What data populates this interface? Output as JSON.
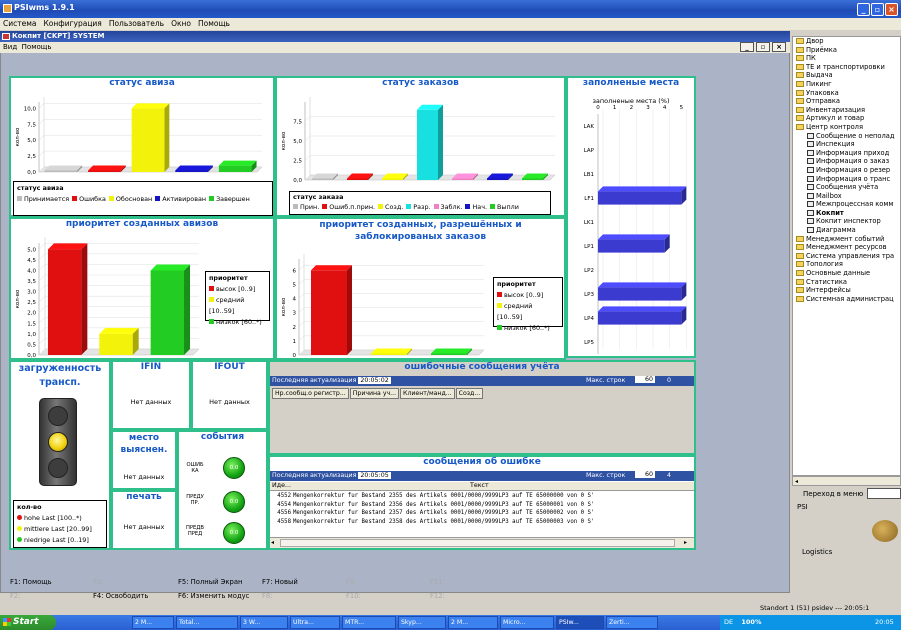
{
  "app": {
    "title": "PSIwms 1.9.1",
    "menu": [
      "Система",
      "Конфигурация",
      "Пользователь",
      "Окно",
      "Помощь"
    ]
  },
  "inner": {
    "title": "Кокпит [CKPT] SYSTEM",
    "menu": [
      "Вид",
      "Помощь"
    ]
  },
  "panels": {
    "avis_status": {
      "title": "статус авиза",
      "ylabel": "кол-во",
      "legend_title": "статус авиза",
      "legend": [
        {
          "label": "Принимается",
          "color": "#bbbbbb"
        },
        {
          "label": "Ошибка",
          "color": "#e01010"
        },
        {
          "label": "Обоснован",
          "color": "#f2f20a"
        },
        {
          "label": "Активирован",
          "color": "#1515c0"
        },
        {
          "label": "Завершен",
          "color": "#22cc22"
        }
      ]
    },
    "order_status": {
      "title": "статус заказов",
      "ylabel": "кол-во",
      "legend_title": "статус заказа",
      "legend": [
        {
          "label": "Прин.",
          "color": "#bbbbbb"
        },
        {
          "label": "Ошиб.п.прин.",
          "color": "#e01010"
        },
        {
          "label": "Созд.",
          "color": "#f2f20a"
        },
        {
          "label": "Разр.",
          "color": "#19e0e0"
        },
        {
          "label": "Заблк.",
          "color": "#f080c0"
        },
        {
          "label": "Нач.",
          "color": "#1515c0"
        },
        {
          "label": "Выпли",
          "color": "#22cc22"
        }
      ]
    },
    "places": {
      "title": "заполненые места",
      "subtitle": "заполненые места (%)"
    },
    "avis_priority": {
      "title": "приоритет созданных авизов",
      "ylabel": "кол-во",
      "legend_title": "приоритет",
      "legend": [
        {
          "label": "высок [0..9]",
          "color": "#e01010"
        },
        {
          "label": "средний [10..59]",
          "color": "#f2f20a"
        },
        {
          "label": "низкок [60..*)",
          "color": "#22cc22"
        }
      ]
    },
    "order_priority": {
      "title1": "приоритет созданных, разрешённых и",
      "title2": "заблокированых заказов",
      "ylabel": "кол-во",
      "legend_title": "приоритет",
      "legend": [
        {
          "label": "высок [0..9]",
          "color": "#e01010"
        },
        {
          "label": "средний [10..59]",
          "color": "#f2f20a"
        },
        {
          "label": "низкок [60..*)",
          "color": "#22cc22"
        }
      ]
    },
    "load": {
      "title1": "загруженность",
      "title2": "трансп.",
      "legend_title": "кол-во",
      "legend": [
        {
          "label": "hohe Last [100..*)",
          "color": "#e01010"
        },
        {
          "label": "mittlere Last [20..99]",
          "color": "#f2f20a"
        },
        {
          "label": "niedrige Last [0..19]",
          "color": "#22cc22"
        }
      ]
    },
    "ifin": {
      "title": "IFIN",
      "text": "Нет данных"
    },
    "ifout": {
      "title": "IFOUT",
      "text": "Нет данных"
    },
    "place_clar": {
      "title1": "место",
      "title2": "выяснен.",
      "text": "Нет данных"
    },
    "print": {
      "title": "печать",
      "text": "Нет данных"
    },
    "events": {
      "title": "события",
      "items": [
        {
          "label1": "ОШИБ",
          "label2": "КА",
          "value": "0.0"
        },
        {
          "label1": "ПРЕДУ",
          "label2": "ПР.",
          "value": "0.0"
        },
        {
          "label1": "ПРЕДВ",
          "label2": "ПРЕД",
          "value": "0.0"
        }
      ]
    },
    "booking_errors": {
      "title": "ошибочные сообщения учёта",
      "last_update_label": "Последняя актуализация",
      "last_update": "20:05:02",
      "max_rows_label": "Макс. строк",
      "max_rows": "60",
      "count": "0",
      "columns": [
        "Нр.сообщ.о регистр...",
        "Причина уч...",
        "Клиент/манд...",
        "Созд..."
      ]
    },
    "error_messages": {
      "title": "сообщения об ошибке",
      "last_update_label": "Последняя актуализация",
      "last_update": "20:05:05",
      "max_rows_label": "Макс. строк",
      "max_rows": "60",
      "count": "4",
      "columns": [
        "Иде...",
        "Текст"
      ],
      "rows": [
        {
          "id": "4552",
          "text": "Mengenkorrektur fur Bestand 2355 des Artikels 0001/0000/9999LP3 auf TE 65000000 von 0 S'"
        },
        {
          "id": "4554",
          "text": "Mengenkorrektur fur Bestand 2356 des Artikels 0001/0000/9999LP3 auf TE 65000001 von 0 S'"
        },
        {
          "id": "4556",
          "text": "Mengenkorrektur fur Bestand 2357 des Artikels 0001/0000/9999LP3 auf TE 65000002 von 0 S'"
        },
        {
          "id": "4558",
          "text": "Mengenkorrektur fur Bestand 2358 des Artikels 0001/0000/9999LP3 auf TE 65000003 von 0 S'"
        }
      ]
    }
  },
  "chart_data": [
    {
      "type": "bar",
      "title": "статус авиза",
      "ylabel": "кол-во",
      "categories": [
        "Принимается",
        "Ошибка",
        "Обоснован",
        "Активирован",
        "Завершен"
      ],
      "values": [
        0,
        0,
        10,
        0,
        1
      ],
      "yticks": [
        "0,0",
        "2,5",
        "5,0",
        "7,5",
        "10,0"
      ],
      "ylim": [
        0,
        11
      ],
      "colors": [
        "#bbbbbb",
        "#e01010",
        "#f2f20a",
        "#1515c0",
        "#22cc22"
      ]
    },
    {
      "type": "bar",
      "title": "статус заказов",
      "ylabel": "кол-во",
      "categories": [
        "Прин.",
        "Ошиб.п.прин.",
        "Созд.",
        "Разр.",
        "Заблк.",
        "Нач.",
        "Выпли"
      ],
      "values": [
        0,
        0,
        0,
        9,
        0,
        0,
        0
      ],
      "yticks": [
        "0,0",
        "2,5",
        "5,0",
        "7,5"
      ],
      "ylim": [
        0,
        10
      ],
      "colors": [
        "#bbbbbb",
        "#e01010",
        "#f2f20a",
        "#19e0e0",
        "#f080c0",
        "#1515c0",
        "#22cc22"
      ]
    },
    {
      "type": "bar",
      "orientation": "horizontal",
      "title": "заполненые места",
      "subtitle": "заполненые места (%)",
      "categories": [
        "LAK",
        "LAP",
        "LB1",
        "LF1",
        "LK1",
        "LP1",
        "LP2",
        "LP3",
        "LP4",
        "LP5"
      ],
      "values": [
        0,
        0,
        0,
        5,
        0,
        4,
        0,
        5,
        5,
        0
      ],
      "xticks": [
        "0",
        "1",
        "2",
        "3",
        "4",
        "5"
      ],
      "xlim": [
        0,
        5.4
      ],
      "color": "#3b3bd0"
    },
    {
      "type": "bar",
      "title": "приоритет созданных авизов",
      "ylabel": "кол-во",
      "categories": [
        "высок [0..9]",
        "средний [10..59]",
        "низкок [60..*)"
      ],
      "values": [
        5,
        1,
        4
      ],
      "yticks": [
        "0,0",
        "0,5",
        "1,0",
        "1,5",
        "2,0",
        "2,5",
        "3,0",
        "3,5",
        "4,0",
        "4,5",
        "5,0"
      ],
      "ylim": [
        0,
        5.3
      ],
      "colors": [
        "#e01010",
        "#f2f20a",
        "#22cc22"
      ]
    },
    {
      "type": "bar",
      "title": "приоритет созданных, разрешённых и заблокированых заказов",
      "ylabel": "кол-во",
      "categories": [
        "высок [0..9]",
        "средний [10..59]",
        "низкок [60..*)"
      ],
      "values": [
        6,
        0,
        0
      ],
      "yticks": [
        "0",
        "1",
        "2",
        "3",
        "4",
        "5",
        "6"
      ],
      "ylim": [
        0,
        6.8
      ],
      "colors": [
        "#e01010",
        "#f2f20a",
        "#22cc22"
      ]
    }
  ],
  "tree": {
    "items": [
      {
        "label": "Двор",
        "type": "folder",
        "level": 0
      },
      {
        "label": "Приёмка",
        "type": "folder",
        "level": 0
      },
      {
        "label": "ПК",
        "type": "folder",
        "level": 0
      },
      {
        "label": "ТЕ и транспортировки",
        "type": "folder",
        "level": 0
      },
      {
        "label": "Выдача",
        "type": "folder",
        "level": 0
      },
      {
        "label": "Пикинг",
        "type": "folder",
        "level": 0
      },
      {
        "label": "Упаковка",
        "type": "folder",
        "level": 0
      },
      {
        "label": "Отправка",
        "type": "folder",
        "level": 0
      },
      {
        "label": "Инвентаризация",
        "type": "folder",
        "level": 0
      },
      {
        "label": "Артикул и товар",
        "type": "folder",
        "level": 0
      },
      {
        "label": "Центр контроля",
        "type": "folder",
        "level": 0
      },
      {
        "label": "Сообщение о неполад",
        "type": "doc",
        "level": 1
      },
      {
        "label": "Инспекция",
        "type": "doc",
        "level": 1
      },
      {
        "label": "Информация приход",
        "type": "doc",
        "level": 1
      },
      {
        "label": "Информация о заказ",
        "type": "doc",
        "level": 1
      },
      {
        "label": "Информация о резер",
        "type": "doc",
        "level": 1
      },
      {
        "label": "Информация о транс",
        "type": "doc",
        "level": 1
      },
      {
        "label": "Сообщения учёта",
        "type": "doc",
        "level": 1
      },
      {
        "label": "Mailbox",
        "type": "doc",
        "level": 1
      },
      {
        "label": "Межпроцессная комм",
        "type": "doc",
        "level": 1
      },
      {
        "label": "Кокпит",
        "type": "doc",
        "level": 1,
        "bold": true
      },
      {
        "label": "Кокпит инспектор",
        "type": "doc",
        "level": 1
      },
      {
        "label": "Диаграмма",
        "type": "doc",
        "level": 1
      },
      {
        "label": "Менеджмент событий",
        "type": "folder",
        "level": 0
      },
      {
        "label": "Менеджмент ресурсов",
        "type": "folder",
        "level": 0
      },
      {
        "label": "Система управления тра",
        "type": "folder",
        "level": 0
      },
      {
        "label": "Топология",
        "type": "folder",
        "level": 0
      },
      {
        "label": "Основные данные",
        "type": "folder",
        "level": 0
      },
      {
        "label": "Статистика",
        "type": "folder",
        "level": 0
      },
      {
        "label": "Интерфейсы",
        "type": "folder",
        "level": 0
      },
      {
        "label": "Системная администрац",
        "type": "folder",
        "level": 0
      }
    ]
  },
  "goto_menu_label": "Переход в меню",
  "logo": {
    "main": "PSI",
    "sub": "Logistics"
  },
  "fkeys": [
    {
      "label": "F1: Помощь",
      "enabled": true
    },
    {
      "label": "F2:",
      "enabled": false
    },
    {
      "label": "F3:",
      "enabled": false
    },
    {
      "label": "F4: Освободить",
      "enabled": true
    },
    {
      "label": "F5: Полный Экран",
      "enabled": true
    },
    {
      "label": "F6: Изменить модус",
      "enabled": true
    },
    {
      "label": "F7: Новый",
      "enabled": true
    },
    {
      "label": "F8:",
      "enabled": false
    },
    {
      "label": "F9:",
      "enabled": false
    },
    {
      "label": "F10:",
      "enabled": false
    },
    {
      "label": "F11:",
      "enabled": false
    },
    {
      "label": "F12:",
      "enabled": false
    }
  ],
  "status": {
    "text": "Standort 1 (51)   psidev   ---   20:05:1"
  },
  "taskbar": {
    "start": "Start",
    "tasks": [
      "2 M...",
      "Total...",
      "3 W...",
      "Ultra...",
      "MTR...",
      "Skyp...",
      "2 M...",
      "Micro...",
      "PSIw...",
      "Zerti..."
    ],
    "lang": "DE",
    "zoom": "100%",
    "time": "20:05"
  }
}
